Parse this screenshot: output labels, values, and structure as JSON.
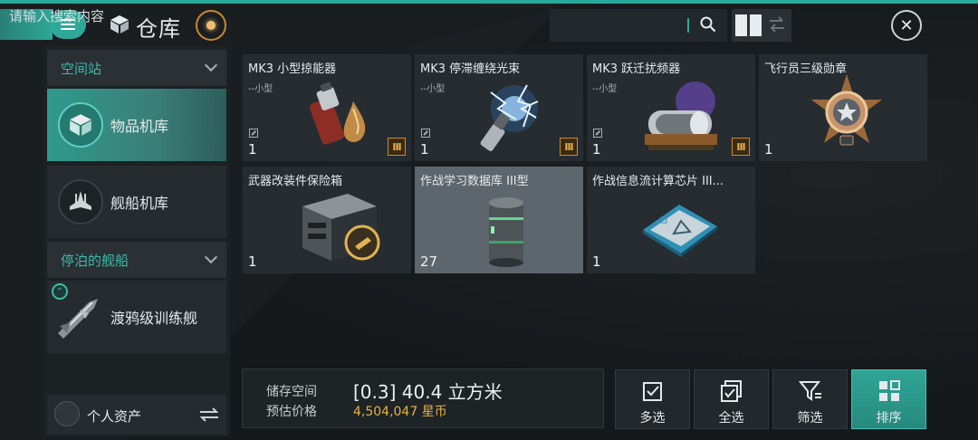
{
  "header": {
    "title": "仓库",
    "search_placeholder": "请输入搜索内容",
    "icons": [
      "menu-icon",
      "cube-icon",
      "target-icon",
      "search-icon",
      "grid-view-icon",
      "swap-icon",
      "close-icon"
    ]
  },
  "sidebar": {
    "sections": [
      {
        "label": "空间站",
        "items": [
          {
            "label": "物品机库",
            "active": true
          },
          {
            "label": "舰船机库",
            "active": false
          }
        ]
      },
      {
        "label": "停泊的舰船",
        "items": [
          {
            "label": "渡鸦级训练舰",
            "active": false
          }
        ]
      }
    ],
    "assets_label": "个人资产"
  },
  "items": [
    {
      "name": "MK3 小型掠能器",
      "sub": "--小型",
      "qty": "1",
      "tier": "III",
      "locked": true
    },
    {
      "name": "MK3 停滞缠绕光束",
      "sub": "--小型",
      "qty": "1",
      "tier": "III",
      "locked": true
    },
    {
      "name": "MK3 跃迁扰频器",
      "sub": "--小型",
      "qty": "1",
      "tier": "III",
      "locked": true
    },
    {
      "name": "飞行员三级勋章",
      "sub": "",
      "qty": "1",
      "tier": "",
      "locked": false
    },
    {
      "name": "武器改装件保险箱",
      "sub": "",
      "qty": "1",
      "tier": "",
      "locked": false
    },
    {
      "name": "作战学习数据库 III型",
      "sub": "",
      "qty": "27",
      "tier": "",
      "locked": false,
      "selected": true
    },
    {
      "name": "作战信息流计算芯片 III...",
      "sub": "",
      "qty": "1",
      "tier": "",
      "locked": false
    }
  ],
  "storage": {
    "label_space": "储存空间",
    "label_price": "预估价格",
    "capacity": "[0.3] 40.4 立方米",
    "price": "4,504,047 星币"
  },
  "actions": [
    {
      "label": "多选",
      "icon": "multi-select-icon",
      "active": false
    },
    {
      "label": "全选",
      "icon": "select-all-icon",
      "active": false
    },
    {
      "label": "筛选",
      "icon": "filter-icon",
      "active": false
    },
    {
      "label": "排序",
      "icon": "sort-icon",
      "active": true
    }
  ],
  "colors": {
    "accent": "#2ea899",
    "tier": "#c88d2f",
    "price": "#e4b341",
    "panel": "#262c30"
  }
}
